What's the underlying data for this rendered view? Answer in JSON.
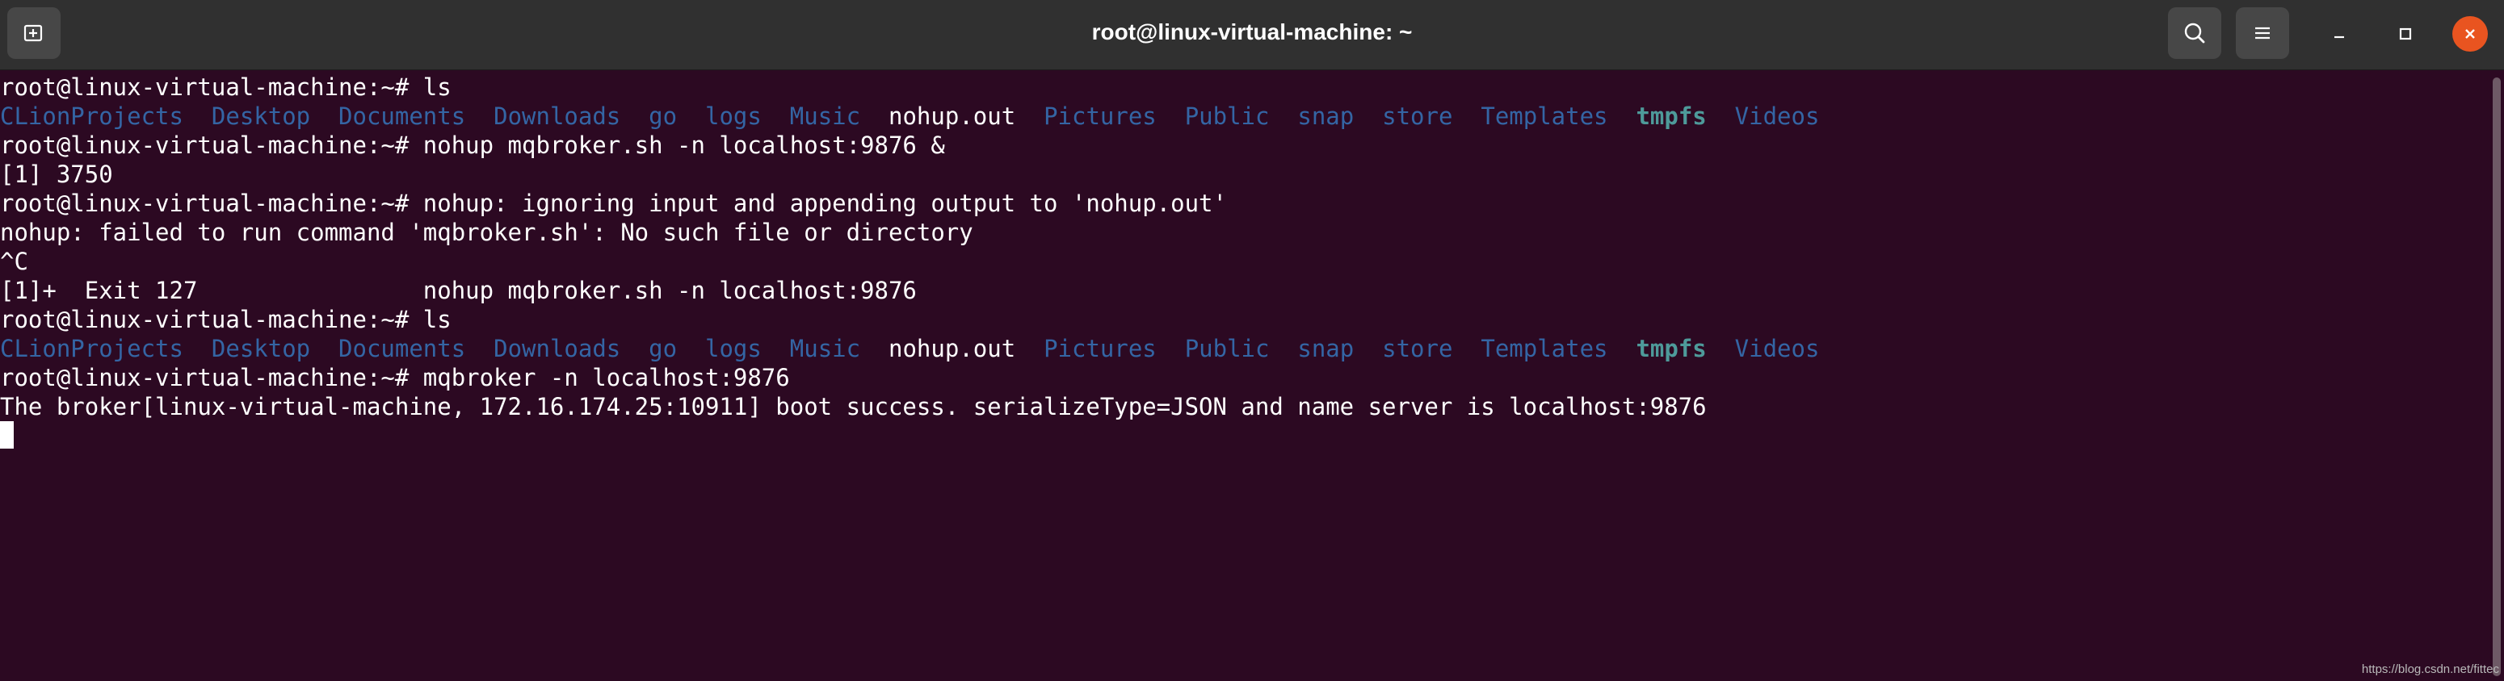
{
  "window": {
    "title": "root@linux-virtual-machine: ~"
  },
  "icons": {
    "new_tab": "new-tab-icon",
    "search": "search-icon",
    "menu": "hamburger-menu-icon",
    "minimize": "minimize-icon",
    "maximize": "maximize-icon",
    "close": "close-icon"
  },
  "colors": {
    "background": "#2c0922",
    "directory": "#3465a4",
    "highlight_directory": "#4e9a9a",
    "close_button": "#e95420"
  },
  "terminal": {
    "lines": [
      [
        {
          "text": "root@linux-virtual-machine:~# ls",
          "kind": "plain"
        }
      ],
      [
        {
          "text": "CLionProjects",
          "kind": "dir"
        },
        {
          "text": "  ",
          "kind": "plain"
        },
        {
          "text": "Desktop",
          "kind": "dir"
        },
        {
          "text": "  ",
          "kind": "plain"
        },
        {
          "text": "Documents",
          "kind": "dir"
        },
        {
          "text": "  ",
          "kind": "plain"
        },
        {
          "text": "Downloads",
          "kind": "dir"
        },
        {
          "text": "  ",
          "kind": "plain"
        },
        {
          "text": "go",
          "kind": "dir"
        },
        {
          "text": "  ",
          "kind": "plain"
        },
        {
          "text": "logs",
          "kind": "dir"
        },
        {
          "text": "  ",
          "kind": "plain"
        },
        {
          "text": "Music",
          "kind": "dir"
        },
        {
          "text": "  ",
          "kind": "plain"
        },
        {
          "text": "nohup.out",
          "kind": "plain"
        },
        {
          "text": "  ",
          "kind": "plain"
        },
        {
          "text": "Pictures",
          "kind": "dir"
        },
        {
          "text": "  ",
          "kind": "plain"
        },
        {
          "text": "Public",
          "kind": "dir"
        },
        {
          "text": "  ",
          "kind": "plain"
        },
        {
          "text": "snap",
          "kind": "dir"
        },
        {
          "text": "  ",
          "kind": "plain"
        },
        {
          "text": "store",
          "kind": "dir"
        },
        {
          "text": "  ",
          "kind": "plain"
        },
        {
          "text": "Templates",
          "kind": "dir"
        },
        {
          "text": "  ",
          "kind": "plain"
        },
        {
          "text": "tmpfs",
          "kind": "dir-green"
        },
        {
          "text": "  ",
          "kind": "plain"
        },
        {
          "text": "Videos",
          "kind": "dir"
        }
      ],
      [
        {
          "text": "root@linux-virtual-machine:~# nohup mqbroker.sh -n localhost:9876 &",
          "kind": "plain"
        }
      ],
      [
        {
          "text": "[1] 3750",
          "kind": "plain"
        }
      ],
      [
        {
          "text": "root@linux-virtual-machine:~# nohup: ignoring input and appending output to 'nohup.out'",
          "kind": "plain"
        }
      ],
      [
        {
          "text": "nohup: failed to run command 'mqbroker.sh': No such file or directory",
          "kind": "plain"
        }
      ],
      [
        {
          "text": "^C",
          "kind": "plain"
        }
      ],
      [
        {
          "text": "[1]+  Exit 127                nohup mqbroker.sh -n localhost:9876",
          "kind": "plain"
        }
      ],
      [
        {
          "text": "root@linux-virtual-machine:~# ls",
          "kind": "plain"
        }
      ],
      [
        {
          "text": "CLionProjects",
          "kind": "dir"
        },
        {
          "text": "  ",
          "kind": "plain"
        },
        {
          "text": "Desktop",
          "kind": "dir"
        },
        {
          "text": "  ",
          "kind": "plain"
        },
        {
          "text": "Documents",
          "kind": "dir"
        },
        {
          "text": "  ",
          "kind": "plain"
        },
        {
          "text": "Downloads",
          "kind": "dir"
        },
        {
          "text": "  ",
          "kind": "plain"
        },
        {
          "text": "go",
          "kind": "dir"
        },
        {
          "text": "  ",
          "kind": "plain"
        },
        {
          "text": "logs",
          "kind": "dir"
        },
        {
          "text": "  ",
          "kind": "plain"
        },
        {
          "text": "Music",
          "kind": "dir"
        },
        {
          "text": "  ",
          "kind": "plain"
        },
        {
          "text": "nohup.out",
          "kind": "plain"
        },
        {
          "text": "  ",
          "kind": "plain"
        },
        {
          "text": "Pictures",
          "kind": "dir"
        },
        {
          "text": "  ",
          "kind": "plain"
        },
        {
          "text": "Public",
          "kind": "dir"
        },
        {
          "text": "  ",
          "kind": "plain"
        },
        {
          "text": "snap",
          "kind": "dir"
        },
        {
          "text": "  ",
          "kind": "plain"
        },
        {
          "text": "store",
          "kind": "dir"
        },
        {
          "text": "  ",
          "kind": "plain"
        },
        {
          "text": "Templates",
          "kind": "dir"
        },
        {
          "text": "  ",
          "kind": "plain"
        },
        {
          "text": "tmpfs",
          "kind": "dir-green"
        },
        {
          "text": "  ",
          "kind": "plain"
        },
        {
          "text": "Videos",
          "kind": "dir"
        }
      ],
      [
        {
          "text": "root@linux-virtual-machine:~# mqbroker -n localhost:9876",
          "kind": "plain"
        }
      ],
      [
        {
          "text": "The broker[linux-virtual-machine, 172.16.174.25:10911] boot success. serializeType=JSON and name server is localhost:9876",
          "kind": "plain"
        }
      ]
    ]
  },
  "watermark": "https://blog.csdn.net/fittec"
}
